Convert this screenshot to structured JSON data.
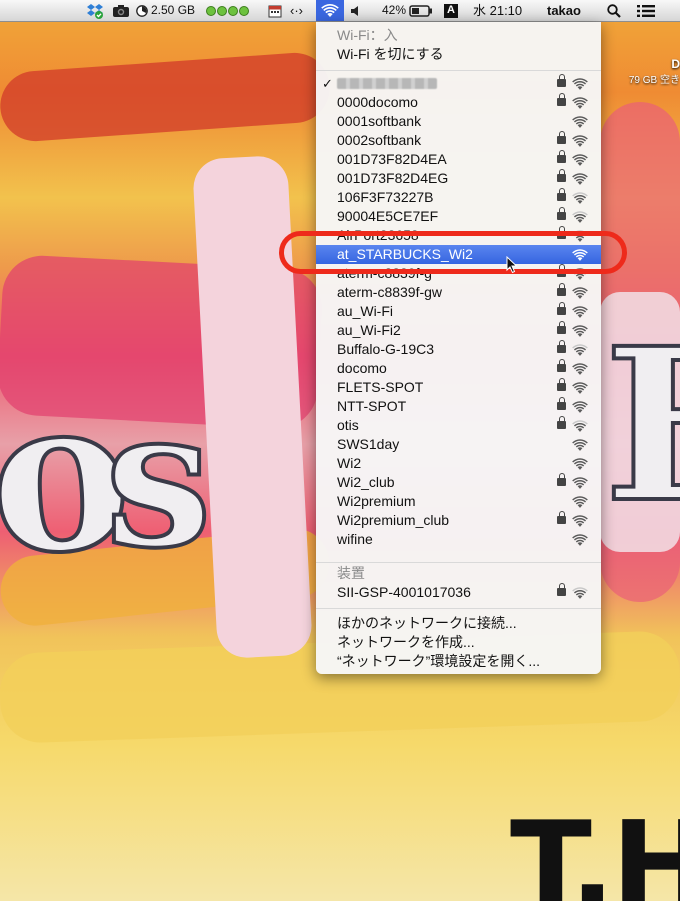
{
  "menubar": {
    "disk_usage": "2.50 GB",
    "battery_percent": "42%",
    "input_source": "A",
    "clock": "水 21:10",
    "user": "takao",
    "icons": [
      "dropbox-icon",
      "camera-icon",
      "disk-meter-icon",
      "status-dots-icon",
      "calendar-icon",
      "code-arrows-icon",
      "wifi-icon",
      "volume-icon",
      "battery-icon",
      "search-icon",
      "list-icon"
    ]
  },
  "desktop": {
    "disk_name": "D",
    "disk_free": "79 GB 空き",
    "painting_text": "T.H"
  },
  "wifi_menu": {
    "status": "Wi-Fi：入",
    "toggle": "Wi-Fi を切にする",
    "connected_check": "✓",
    "networks": [
      {
        "name": "",
        "secured": true,
        "strength": 3,
        "blurred": true,
        "checked": true
      },
      {
        "name": "0000docomo",
        "secured": true,
        "strength": 3
      },
      {
        "name": "0001softbank",
        "secured": false,
        "strength": 3
      },
      {
        "name": "0002softbank",
        "secured": true,
        "strength": 3
      },
      {
        "name": "001D73F82D4EA",
        "secured": true,
        "strength": 3
      },
      {
        "name": "001D73F82D4EG",
        "secured": true,
        "strength": 3
      },
      {
        "name": "106F3F73227B",
        "secured": true,
        "strength": 2
      },
      {
        "name": "90004E5CE7EF",
        "secured": true,
        "strength": 2
      },
      {
        "name": "AirPort23658",
        "secured": true,
        "strength": 1
      },
      {
        "name": "at_STARBUCKS_Wi2",
        "secured": false,
        "strength": 2,
        "highlighted": true
      },
      {
        "name": "aterm-c8839f-g",
        "secured": true,
        "strength": 3
      },
      {
        "name": "aterm-c8839f-gw",
        "secured": true,
        "strength": 3
      },
      {
        "name": "au_Wi-Fi",
        "secured": true,
        "strength": 3
      },
      {
        "name": "au_Wi-Fi2",
        "secured": true,
        "strength": 3
      },
      {
        "name": "Buffalo-G-19C3",
        "secured": true,
        "strength": 2
      },
      {
        "name": "docomo",
        "secured": true,
        "strength": 3
      },
      {
        "name": "FLETS-SPOT",
        "secured": true,
        "strength": 3
      },
      {
        "name": "NTT-SPOT",
        "secured": true,
        "strength": 3
      },
      {
        "name": "otis",
        "secured": true,
        "strength": 2
      },
      {
        "name": "SWS1day",
        "secured": false,
        "strength": 3
      },
      {
        "name": "Wi2",
        "secured": false,
        "strength": 3
      },
      {
        "name": "Wi2_club",
        "secured": true,
        "strength": 3
      },
      {
        "name": "Wi2premium",
        "secured": false,
        "strength": 3
      },
      {
        "name": "Wi2premium_club",
        "secured": true,
        "strength": 3
      },
      {
        "name": "wifine",
        "secured": false,
        "strength": 3
      }
    ],
    "devices_header": "装置",
    "devices": [
      {
        "name": "SII-GSP-4001017036",
        "secured": true,
        "strength": 2
      }
    ],
    "actions": [
      "ほかのネットワークに接続...",
      "ネットワークを作成...",
      "“ネットワーク”環境設定を開く..."
    ]
  },
  "colors": {
    "highlight": "#3a67e0",
    "ring": "#ee2a1b"
  }
}
